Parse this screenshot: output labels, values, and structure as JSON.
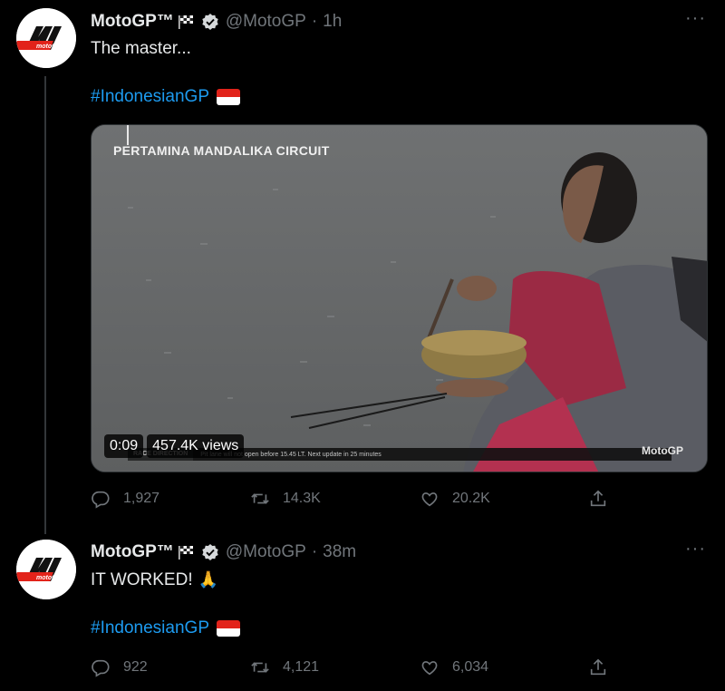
{
  "tweets": [
    {
      "name": "MotoGP™",
      "handle": "@MotoGP",
      "time": "1h",
      "text": "The master...",
      "hashtag": "#IndonesianGP",
      "media": {
        "caption": "PERTAMINA MANDALIKA CIRCUIT",
        "duration": "0:09",
        "views": "457.4K views",
        "ticker_label": "RACE DIRECTION",
        "ticker_text": "Pit lane will not open before 15.45 LT. Next update in 25 minutes",
        "watermark": "MotoGP"
      },
      "replies": "1,927",
      "retweets": "14.3K",
      "likes": "20.2K"
    },
    {
      "name": "MotoGP™",
      "handle": "@MotoGP",
      "time": "38m",
      "text": "IT WORKED!",
      "text_emoji": "🙏",
      "hashtag": "#IndonesianGP",
      "replies": "922",
      "retweets": "4,121",
      "likes": "6,034"
    }
  ],
  "colors": {
    "background": "#000000",
    "text": "#e7e9ea",
    "muted": "#71767b",
    "link": "#1d9bf0",
    "brand_red": "#e2231a"
  },
  "icons": {
    "more": "more-icon",
    "verified": "verified-icon",
    "reply": "reply-icon",
    "retweet": "retweet-icon",
    "like": "heart-icon",
    "share": "share-icon"
  }
}
